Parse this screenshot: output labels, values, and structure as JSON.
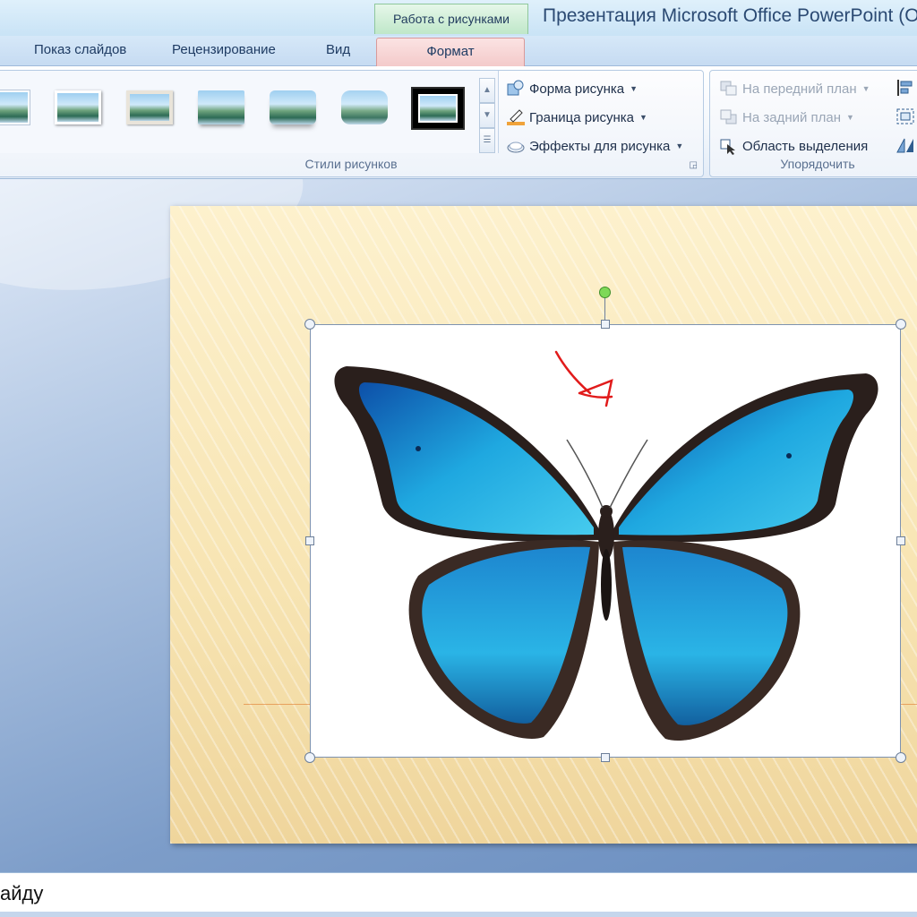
{
  "titlebar": {
    "context_group": "Работа с рисунками",
    "title": "Презентация Microsoft Office PowerPoint (Оф"
  },
  "tabs": [
    {
      "label": "Показ слайдов"
    },
    {
      "label": "Рецензирование"
    },
    {
      "label": "Вид"
    }
  ],
  "active_tab": {
    "label": "Формат"
  },
  "ribbon": {
    "picture_styles": {
      "caption": "Стили рисунков",
      "commands": {
        "shape": "Форма рисунка",
        "border": "Граница рисунка",
        "effects": "Эффекты для рисунка"
      }
    },
    "arrange": {
      "caption": "Упорядочить",
      "commands": {
        "bring_front": "На передний план",
        "send_back": "На задний план",
        "selection_pane": "Область выделения"
      }
    }
  },
  "notes": {
    "text": "айду"
  },
  "colors": {
    "butterfly_blue": "#1fa8e0",
    "butterfly_dark": "#2a1f1c",
    "annotation_red": "#e11b1b",
    "slide_bg": "#f7e4b2"
  }
}
